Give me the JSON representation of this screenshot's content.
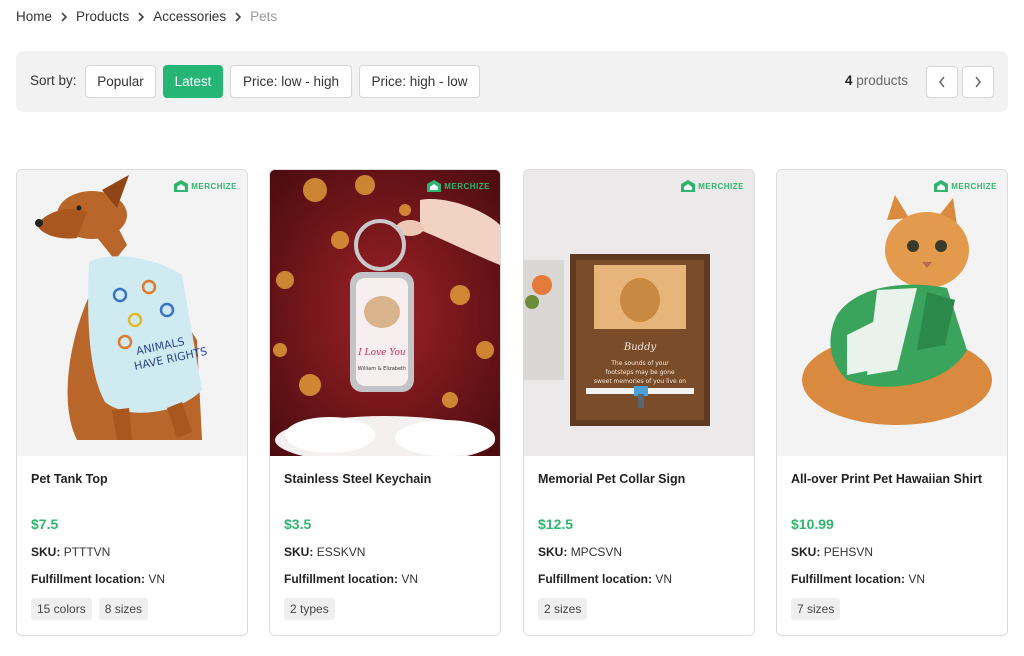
{
  "breadcrumb": {
    "items": [
      "Home",
      "Products",
      "Accessories"
    ],
    "current": "Pets"
  },
  "toolbar": {
    "sort_label": "Sort by:",
    "sort_options": [
      "Popular",
      "Latest",
      "Price: low - high",
      "Price: high - low"
    ],
    "active_sort": "Latest",
    "count_number": "4",
    "count_text": " products",
    "accent_color": "#25b574"
  },
  "brand": "MERCHIZE",
  "products": [
    {
      "title": "Pet Tank Top",
      "price": "$7.5",
      "sku_label": "SKU:",
      "sku": "PTTTVN",
      "location_label": "Fulfillment location:",
      "location": "VN",
      "tags": [
        "15 colors",
        "8 sizes"
      ],
      "image_icon": "dog-in-tank-top"
    },
    {
      "title": "Stainless Steel Keychain",
      "price": "$3.5",
      "sku_label": "SKU:",
      "sku": "ESSKVN",
      "location_label": "Fulfillment location:",
      "location": "VN",
      "tags": [
        "2 types"
      ],
      "image_icon": "keychain"
    },
    {
      "title": "Memorial Pet Collar Sign",
      "price": "$12.5",
      "sku_label": "SKU:",
      "sku": "MPCSVN",
      "location_label": "Fulfillment location:",
      "location": "VN",
      "tags": [
        "2 sizes"
      ],
      "image_icon": "memorial-frame"
    },
    {
      "title": "All-over Print Pet Hawaiian Shirt",
      "price": "$10.99",
      "sku_label": "SKU:",
      "sku": "PEHSVN",
      "location_label": "Fulfillment location:",
      "location": "VN",
      "tags": [
        "7 sizes"
      ],
      "image_icon": "cat-in-shirt"
    }
  ]
}
